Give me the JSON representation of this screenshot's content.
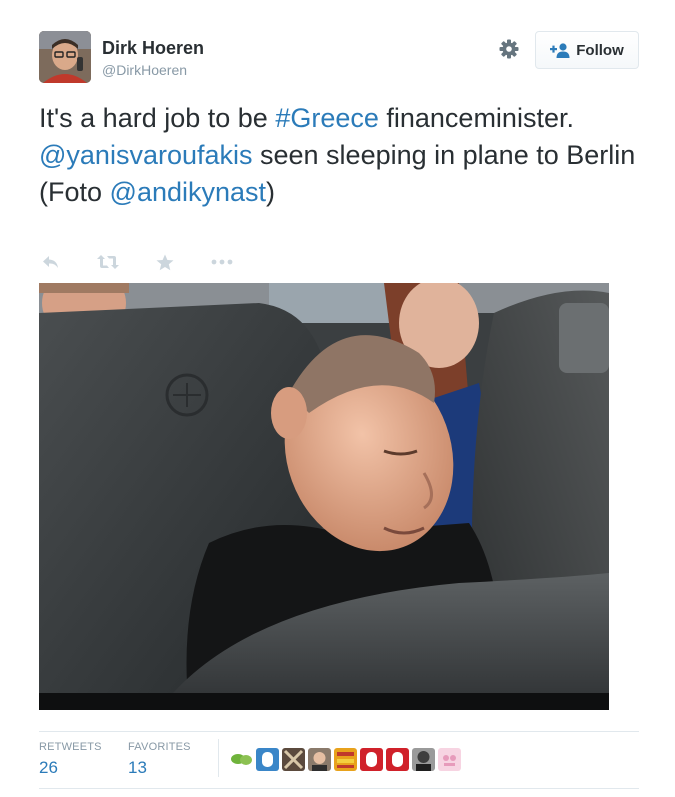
{
  "author": {
    "name": "Dirk Hoeren",
    "handle": "@DirkHoeren"
  },
  "header": {
    "follow_label": "Follow",
    "settings_icon": "gear-icon",
    "follow_icon": "add-user-icon"
  },
  "tweet": {
    "segments": [
      {
        "text": "It's a hard job to be ",
        "type": "text"
      },
      {
        "text": "#Greece",
        "type": "hashtag"
      },
      {
        "text": " financeminister. ",
        "type": "text"
      },
      {
        "text": "@yanisvaroufakis",
        "type": "mention"
      },
      {
        "text": " seen sleeping in plane to Berlin (Foto ",
        "type": "text"
      },
      {
        "text": "@andikynast",
        "type": "mention"
      },
      {
        "text": ")",
        "type": "text"
      }
    ]
  },
  "actions": [
    "reply-icon",
    "retweet-icon",
    "favorite-icon",
    "more-icon"
  ],
  "stats": {
    "retweets_label": "RETWEETS",
    "retweets_count": "26",
    "favorites_label": "FAVORITES",
    "favorites_count": "13"
  },
  "colors": {
    "link": "#2b7bb9",
    "text": "#292f33",
    "muted": "#8899a6",
    "border": "#e1e8ed"
  }
}
